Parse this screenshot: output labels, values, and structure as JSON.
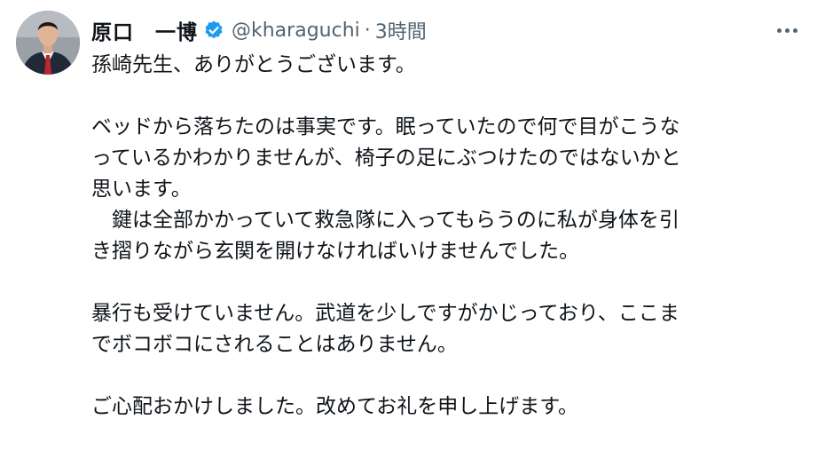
{
  "user": {
    "name": "原口　一博",
    "handle": "@kharaguchi",
    "separator": "·",
    "time": "3時間"
  },
  "icons": {
    "verified": "verified-badge-icon",
    "more": "more-options-icon",
    "verified_color": "#1d9bf0"
  },
  "tweet": {
    "lines": [
      "孫崎先生、ありがとうございます。",
      "",
      "ベッドから落ちたのは事実です。眠っていたので何で目がこうな",
      "っているかわかりませんが、椅子の足にぶつけたのではないかと",
      "思います。",
      "　鍵は全部かかっていて救急隊に入ってもらうのに私が身体を引",
      "き摺りながら玄関を開けなければいけませんでした。",
      "",
      "暴行も受けていません。武道を少しですがかじっており、ここま",
      "でボコボコにされることはありません。",
      "",
      "ご心配おかけしました。改めてお礼を申し上げます。"
    ]
  }
}
